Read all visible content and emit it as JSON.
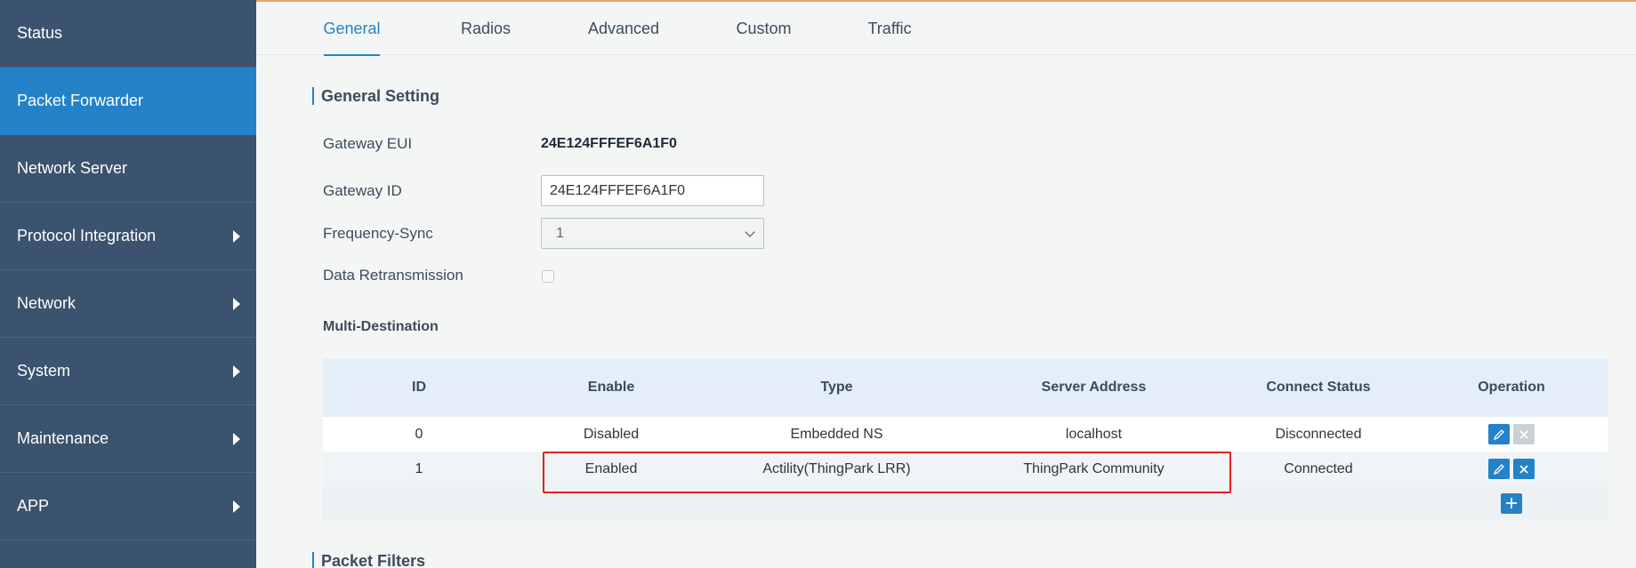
{
  "sidebar": {
    "items": [
      {
        "label": "Status",
        "has_arrow": false,
        "active": false
      },
      {
        "label": "Packet Forwarder",
        "has_arrow": false,
        "active": true
      },
      {
        "label": "Network Server",
        "has_arrow": false,
        "active": false
      },
      {
        "label": "Protocol Integration",
        "has_arrow": true,
        "active": false
      },
      {
        "label": "Network",
        "has_arrow": true,
        "active": false
      },
      {
        "label": "System",
        "has_arrow": true,
        "active": false
      },
      {
        "label": "Maintenance",
        "has_arrow": true,
        "active": false
      },
      {
        "label": "APP",
        "has_arrow": true,
        "active": false
      }
    ]
  },
  "tabs": [
    {
      "label": "General",
      "active": true
    },
    {
      "label": "Radios",
      "active": false
    },
    {
      "label": "Advanced",
      "active": false
    },
    {
      "label": "Custom",
      "active": false
    },
    {
      "label": "Traffic",
      "active": false
    }
  ],
  "general": {
    "title": "General Setting",
    "gateway_eui_label": "Gateway EUI",
    "gateway_eui_value": "24E124FFFEF6A1F0",
    "gateway_id_label": "Gateway ID",
    "gateway_id_value": "24E124FFFEF6A1F0",
    "frequency_sync_label": "Frequency-Sync",
    "frequency_sync_value": "1",
    "data_retransmission_label": "Data Retransmission",
    "data_retransmission_checked": false
  },
  "multi_destination": {
    "title": "Multi-Destination",
    "headers": {
      "id": "ID",
      "enable": "Enable",
      "type": "Type",
      "server_address": "Server Address",
      "connect_status": "Connect Status",
      "operation": "Operation"
    },
    "rows": [
      {
        "id": "0",
        "enable": "Disabled",
        "type": "Embedded NS",
        "server_address": "localhost",
        "connect_status": "Disconnected",
        "delete_enabled": false
      },
      {
        "id": "1",
        "enable": "Enabled",
        "type": "Actility(ThingPark LRR)",
        "server_address": "ThingPark Community",
        "connect_status": "Connected",
        "delete_enabled": true
      }
    ]
  },
  "packet_filters": {
    "title": "Packet Filters"
  },
  "colors": {
    "accent": "#2382c8",
    "sidebar_bg": "#3b536e",
    "highlight_border": "#e02020"
  }
}
